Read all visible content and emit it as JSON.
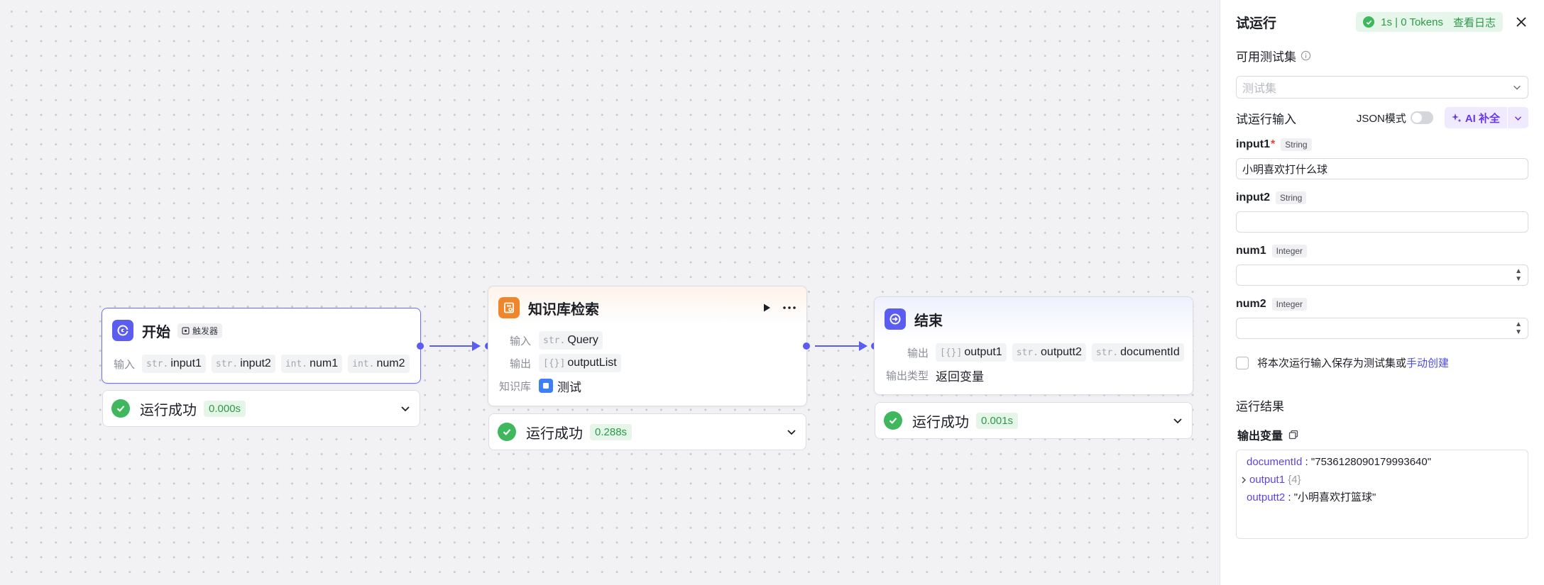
{
  "canvas": {
    "start_node": {
      "title": "开始",
      "tag": "触发器",
      "input_label": "输入",
      "inputs": [
        {
          "type": "str.",
          "name": "input1"
        },
        {
          "type": "str.",
          "name": "input2"
        },
        {
          "type": "int.",
          "name": "num1"
        },
        {
          "type": "int.",
          "name": "num2"
        }
      ],
      "status": "运行成功",
      "time": "0.000s"
    },
    "kb_node": {
      "title": "知识库检索",
      "input_label": "输入",
      "input": {
        "type": "str.",
        "name": "Query"
      },
      "output_label": "输出",
      "output": {
        "type": "[{}]",
        "name": "outputList"
      },
      "kb_label": "知识库",
      "kb_value": "测试",
      "status": "运行成功",
      "time": "0.288s"
    },
    "end_node": {
      "title": "结束",
      "output_label": "输出",
      "outputs": [
        {
          "type": "[{}]",
          "name": "output1"
        },
        {
          "type": "str.",
          "name": "outputt2"
        },
        {
          "type": "str.",
          "name": "documentId"
        }
      ],
      "output_type_label": "输出类型",
      "output_type_value": "返回变量",
      "status": "运行成功",
      "time": "0.001s"
    }
  },
  "panel": {
    "title": "试运行",
    "badge_stats": "1s | 0 Tokens",
    "badge_link": "查看日志",
    "testset_label": "可用测试集",
    "testset_placeholder": "测试集",
    "run_input_label": "试运行输入",
    "json_mode_label": "JSON模式",
    "ai_button": "AI 补全",
    "fields": [
      {
        "name": "input1",
        "required": "*",
        "type": "String",
        "value": "小明喜欢打什么球"
      },
      {
        "name": "input2",
        "required": "",
        "type": "String",
        "value": ""
      },
      {
        "name": "num1",
        "required": "",
        "type": "Integer",
        "value": ""
      },
      {
        "name": "num2",
        "required": "",
        "type": "Integer",
        "value": ""
      }
    ],
    "save_text": "将本次运行输入保存为测试集或",
    "save_link": "手动创建",
    "result_title": "运行结果",
    "output_vars_label": "输出变量",
    "result": [
      {
        "key": "documentId",
        "sep": " : ",
        "value": "\"7536128090179993640\""
      },
      {
        "key": "output1",
        "sep": " ",
        "value": "{4}"
      },
      {
        "key": "outputt2",
        "sep": " : ",
        "value": "\"小明喜欢打篮球\""
      }
    ]
  },
  "colors": {
    "accent": "#5b5cf0",
    "success": "#3fb75c",
    "kb_icon": "#f0862b",
    "ai_purple": "#6a36e8"
  },
  "icons": [
    "start-icon",
    "trigger-icon",
    "knowledge-base-icon",
    "play-icon",
    "more-icon",
    "end-icon",
    "check-icon",
    "chevron-down-icon",
    "close-icon",
    "info-icon",
    "sparkle-icon",
    "copy-icon",
    "chevron-right-icon",
    "database-icon"
  ]
}
